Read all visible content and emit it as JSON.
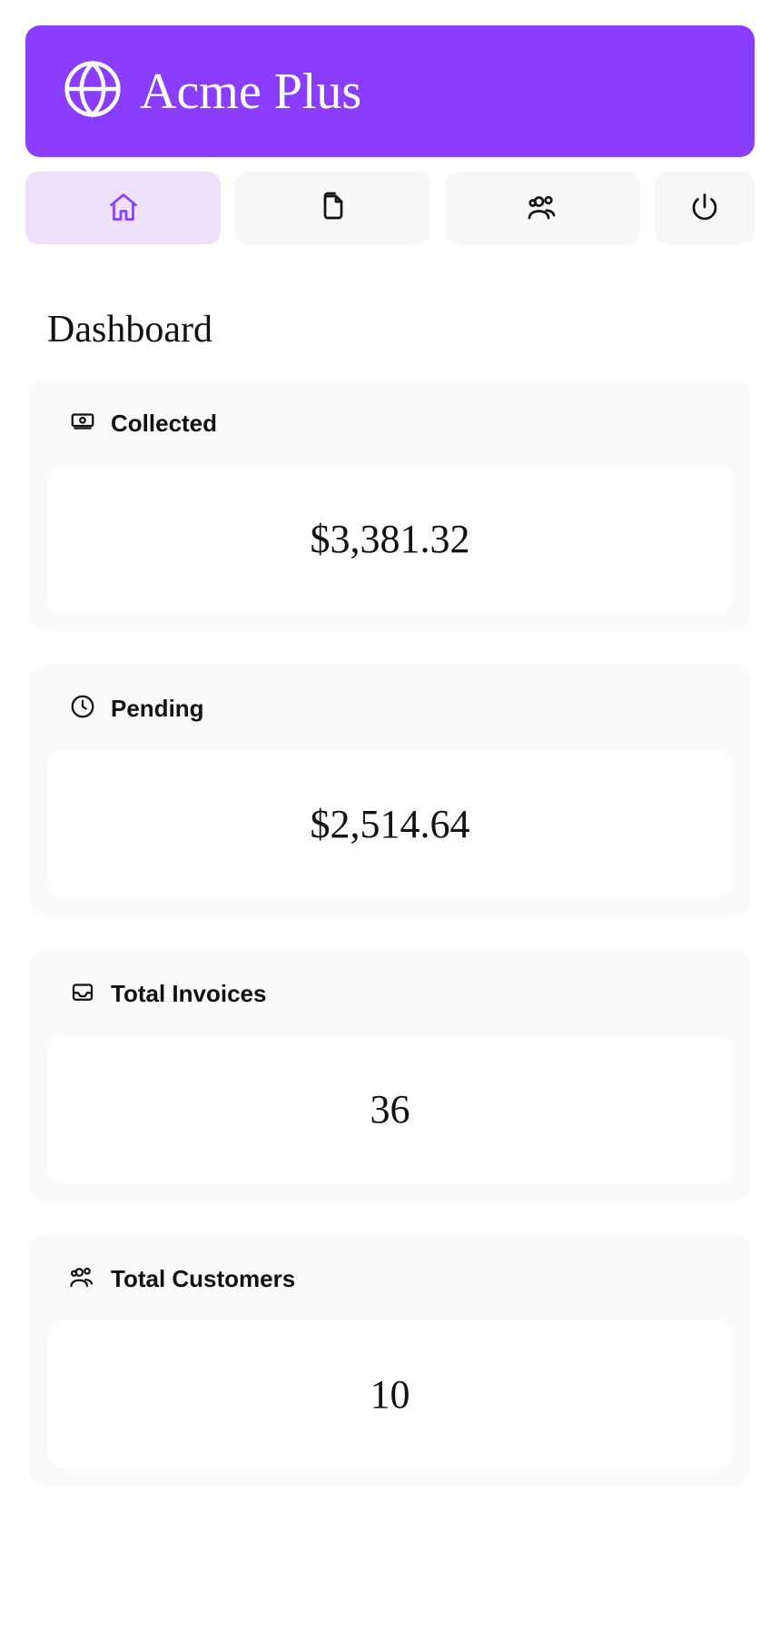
{
  "brand": {
    "name": "Acme Plus"
  },
  "nav": {
    "items": [
      {
        "name": "home",
        "active": true
      },
      {
        "name": "documents",
        "active": false
      },
      {
        "name": "customers",
        "active": false
      },
      {
        "name": "power",
        "active": false
      }
    ]
  },
  "page": {
    "title": "Dashboard"
  },
  "cards": [
    {
      "label": "Collected",
      "value": "$3,381.32",
      "icon": "banknotes"
    },
    {
      "label": "Pending",
      "value": "$2,514.64",
      "icon": "clock"
    },
    {
      "label": "Total Invoices",
      "value": "36",
      "icon": "inbox"
    },
    {
      "label": "Total Customers",
      "value": "10",
      "icon": "users"
    }
  ]
}
